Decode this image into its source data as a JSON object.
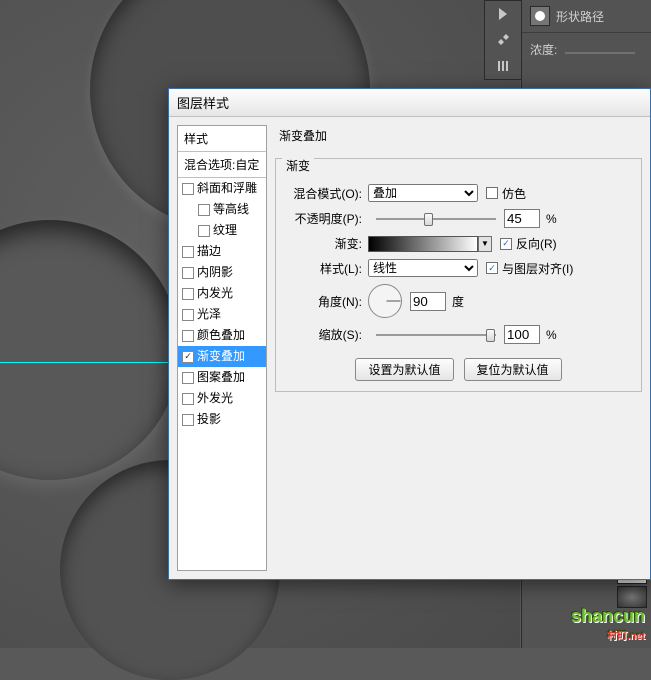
{
  "right_panel": {
    "shape_path": "形状路径",
    "depth": "浓度:"
  },
  "dialog": {
    "title": "图层样式",
    "styles_header": "样式",
    "blend_options": "混合选项:自定",
    "items": [
      {
        "label": "斜面和浮雕",
        "checked": false,
        "indent": false
      },
      {
        "label": "等高线",
        "checked": false,
        "indent": true
      },
      {
        "label": "纹理",
        "checked": false,
        "indent": true
      },
      {
        "label": "描边",
        "checked": false,
        "indent": false
      },
      {
        "label": "内阴影",
        "checked": false,
        "indent": false
      },
      {
        "label": "内发光",
        "checked": false,
        "indent": false
      },
      {
        "label": "光泽",
        "checked": false,
        "indent": false
      },
      {
        "label": "颜色叠加",
        "checked": false,
        "indent": false
      },
      {
        "label": "渐变叠加",
        "checked": true,
        "indent": false,
        "selected": true
      },
      {
        "label": "图案叠加",
        "checked": false,
        "indent": false
      },
      {
        "label": "外发光",
        "checked": false,
        "indent": false
      },
      {
        "label": "投影",
        "checked": false,
        "indent": false
      }
    ],
    "section_title": "渐变叠加",
    "group_title": "渐变",
    "blend_mode_label": "混合模式(O):",
    "blend_mode_value": "叠加",
    "dither_label": "仿色",
    "dither_checked": false,
    "opacity_label": "不透明度(P):",
    "opacity_value": "45",
    "percent": "%",
    "gradient_label": "渐变:",
    "reverse_label": "反向(R)",
    "reverse_checked": true,
    "style_label": "样式(L):",
    "style_value": "线性",
    "align_label": "与图层对齐(I)",
    "align_checked": true,
    "angle_label": "角度(N):",
    "angle_value": "90",
    "angle_unit": "度",
    "scale_label": "缩放(S):",
    "scale_value": "100",
    "btn_default": "设置为默认值",
    "btn_reset": "复位为默认值"
  },
  "watermark": {
    "main": "shancun",
    "sub": "村町.net"
  }
}
